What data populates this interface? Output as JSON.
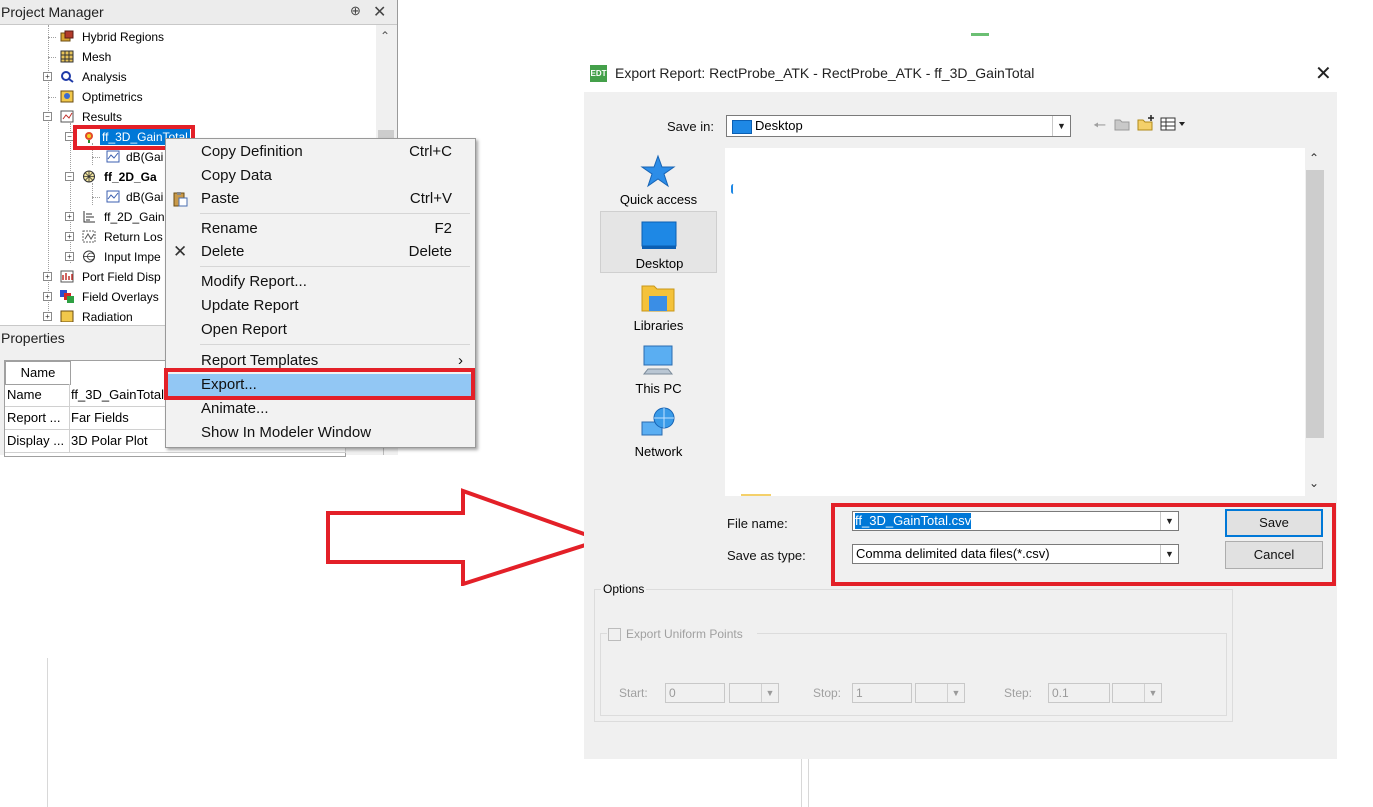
{
  "project_manager": {
    "title": "Project Manager",
    "pin_glyph": "⊕",
    "close_glyph": "✕",
    "tree": [
      {
        "label": "Hybrid Regions",
        "expander": ""
      },
      {
        "label": "Mesh",
        "expander": ""
      },
      {
        "label": "Analysis",
        "expander": "+"
      },
      {
        "label": "Optimetrics",
        "expander": ""
      },
      {
        "label": "Results",
        "expander": "−"
      },
      {
        "label": "ff_3D_GainTotal",
        "expander": "−"
      },
      {
        "label": "dB(Gai",
        "expander": ""
      },
      {
        "label": "ff_2D_Ga",
        "expander": "−"
      },
      {
        "label": "dB(Gai",
        "expander": ""
      },
      {
        "label": "ff_2D_Gain",
        "expander": "+"
      },
      {
        "label": "Return Los",
        "expander": "+"
      },
      {
        "label": "Input Impe",
        "expander": "+"
      },
      {
        "label": "Port Field Disp",
        "expander": "+"
      },
      {
        "label": "Field Overlays",
        "expander": "+"
      },
      {
        "label": "Radiation",
        "expander": "+"
      }
    ]
  },
  "properties": {
    "title": "Properties",
    "header": "Name",
    "rows": [
      {
        "name": "Name",
        "value": "ff_3D_GainTotal"
      },
      {
        "name": "Report ...",
        "value": "Far Fields"
      },
      {
        "name": "Display ...",
        "value": "3D Polar Plot"
      }
    ]
  },
  "context_menu": {
    "items": [
      {
        "label": "Copy Definition",
        "shortcut": "Ctrl+C"
      },
      {
        "label": "Copy Data",
        "shortcut": ""
      },
      {
        "label": "Paste",
        "shortcut": "Ctrl+V"
      },
      {
        "label": "Rename",
        "shortcut": "F2"
      },
      {
        "label": "Delete",
        "shortcut": "Delete"
      },
      {
        "label": "Modify Report...",
        "shortcut": ""
      },
      {
        "label": "Update Report",
        "shortcut": ""
      },
      {
        "label": "Open Report",
        "shortcut": ""
      },
      {
        "label": "Report Templates",
        "shortcut": "›"
      },
      {
        "label": "Export...",
        "shortcut": ""
      },
      {
        "label": "Animate...",
        "shortcut": ""
      },
      {
        "label": "Show In Modeler Window",
        "shortcut": ""
      }
    ],
    "highlight_color": "#92c7f4"
  },
  "dialog": {
    "app_icon_text": "EDT",
    "title": "Export Report: RectProbe_ATK - RectProbe_ATK - ff_3D_GainTotal",
    "close_glyph": "✕",
    "save_in_label": "Save in:",
    "save_in_value": "Desktop",
    "places": [
      {
        "label": "Quick access"
      },
      {
        "label": "Desktop"
      },
      {
        "label": "Libraries"
      },
      {
        "label": "This PC"
      },
      {
        "label": "Network"
      }
    ],
    "file_name_label": "File name:",
    "file_name_value": "ff_3D_GainTotal.csv",
    "save_as_type_label": "Save as type:",
    "save_as_type_value": "Comma delimited data files(*.csv)",
    "save_button": "Save",
    "cancel_button": "Cancel",
    "options": {
      "title": "Options",
      "export_uniform_points": "Export Uniform Points",
      "start_label": "Start:",
      "start_value": "0",
      "stop_label": "Stop:",
      "stop_value": "1",
      "step_label": "Step:",
      "step_value": "0.1"
    }
  },
  "colors": {
    "highlight_red": "#e32028",
    "selection_blue": "#0078d7"
  }
}
